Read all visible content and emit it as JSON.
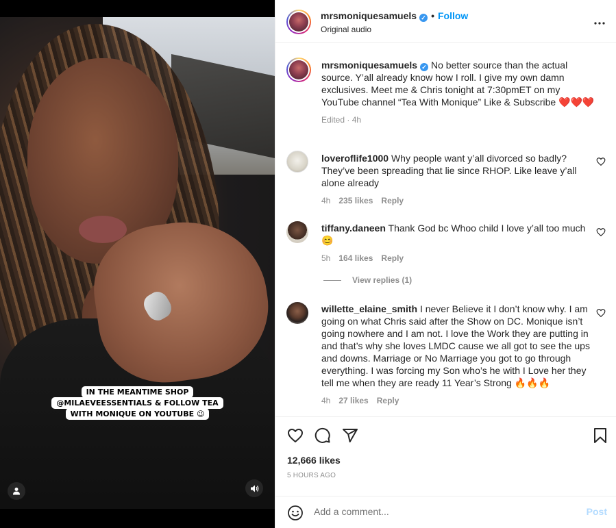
{
  "post": {
    "username": "mrsmoniquesamuels",
    "follow_label": "Follow",
    "audio": "Original audio",
    "more": "•••"
  },
  "video": {
    "caption_lines": [
      "IN THE MEANTIME SHOP",
      "@MILAEVEESSENTIALS  & FOLLOW TEA",
      "WITH MONIQUE ON YOUTUBE 😉"
    ]
  },
  "caption": {
    "username": "mrsmoniquesamuels",
    "text": "No better source than the actual source. Y’all already know how I roll. I give my own damn exclusives. Meet me & Chris tonight at 7:30pmET on my YouTube channel “Tea With Monique” Like & Subscribe ❤️❤️❤️",
    "meta": "Edited · 4h"
  },
  "comments": [
    {
      "username": "loveroflife1000",
      "text": "Why people want y’all divorced so badly? They’ve been spreading that lie since RHOP. Like leave y’all alone already",
      "time": "4h",
      "likes": "235 likes",
      "reply": "Reply"
    },
    {
      "username": "tiffany.daneen",
      "text": "Thank God bc Whoo child I love y’all too much 😊",
      "time": "5h",
      "likes": "164 likes",
      "reply": "Reply",
      "view_replies": "View replies (1)"
    },
    {
      "username": "willette_elaine_smith",
      "text": "I never Believe it I don’t know why. I am going on what Chris said after the Show on DC. Monique isn’t going nowhere and I am not. I love the Work they are putting in and that’s why she loves LMDC cause we all got to see the ups and downs. Marriage or No Marriage you got to go through everything. I was forcing my Son who’s he with I Love her they tell me when they are ready 11 Year’s Strong 🔥🔥🔥",
      "time": "4h",
      "likes": "27 likes",
      "reply": "Reply"
    }
  ],
  "engagement": {
    "likes": "12,666 likes",
    "time_ago": "5 HOURS AGO"
  },
  "add_comment": {
    "placeholder": "Add a comment...",
    "post_label": "Post"
  },
  "colors": {
    "accent": "#0095f6",
    "verified": "#3897f0",
    "post_disabled": "#b3dbff",
    "muted": "#8e8e8e"
  }
}
